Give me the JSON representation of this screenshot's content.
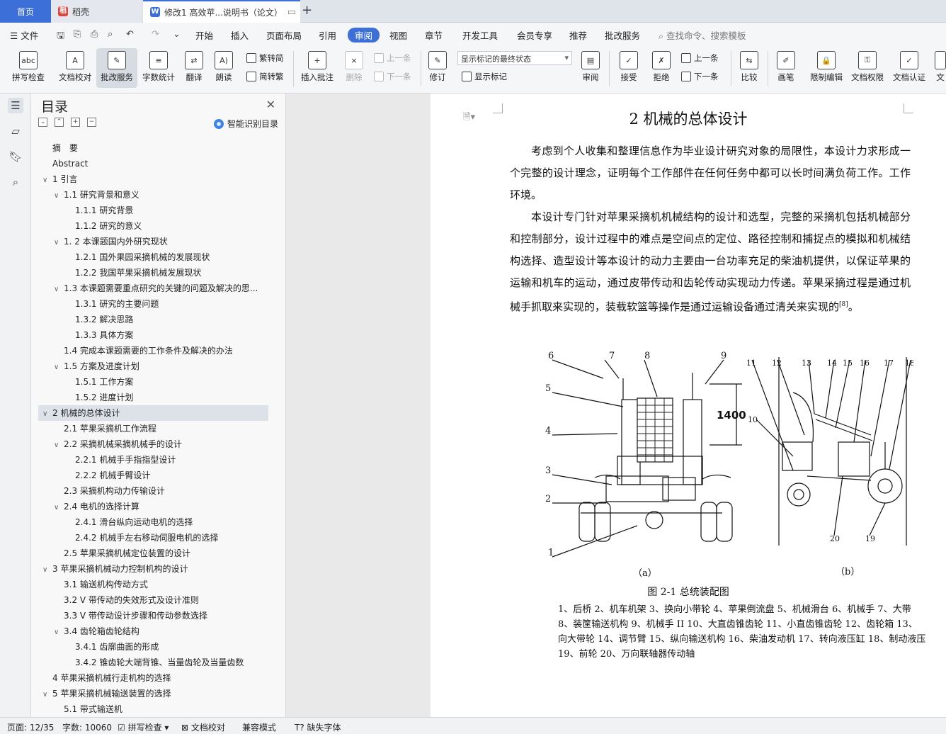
{
  "tabs": {
    "home": "首页",
    "daoke": "稻壳",
    "doc": "修改1 高效苹...说明书（论文）"
  },
  "menu": {
    "file": "文件",
    "items": [
      "开始",
      "插入",
      "页面布局",
      "引用",
      "审阅",
      "视图",
      "章节",
      "开发工具",
      "会员专享",
      "推荐",
      "批改服务"
    ],
    "active": "审阅",
    "search": "查找命令、搜索模板"
  },
  "ribbon": {
    "spellcheck": "拼写检查",
    "doccheck": "文档校对",
    "correction": "批改服务",
    "wordcount": "字数统计",
    "translate": "翻译",
    "read": "朗读",
    "trad": "繁转简",
    "simp": "简转繁",
    "insert_comment": "插入批注",
    "delete": "删除",
    "prev_comment": "上一条",
    "next_comment": "下一条",
    "revise": "修订",
    "markup_state": "显示标记的最终状态",
    "show_markup": "显示标记",
    "review": "审阅",
    "accept": "接受",
    "reject": "拒绝",
    "prev_change": "上一条",
    "next_change": "下一条",
    "compare": "比较",
    "pen": "画笔",
    "restrict": "限制编辑",
    "permission": "文档权限",
    "certify": "文档认证",
    "cut_label": "文"
  },
  "toc": {
    "title": "目录",
    "smart": "智能识别目录",
    "items": [
      {
        "text": "摘　要",
        "level": 0,
        "chev": ""
      },
      {
        "text": "Abstract",
        "level": 0,
        "chev": ""
      },
      {
        "text": "1 引言",
        "level": 0,
        "chev": "∨"
      },
      {
        "text": "1.1 研究背景和意义",
        "level": 1,
        "chev": "∨"
      },
      {
        "text": "1.1.1 研究背景",
        "level": 2,
        "chev": ""
      },
      {
        "text": "1.1.2 研究的意义",
        "level": 2,
        "chev": ""
      },
      {
        "text": "1. 2 本课题国内外研究现状",
        "level": 1,
        "chev": "∨"
      },
      {
        "text": "1.2.1 国外果园采摘机械的发展现状",
        "level": 2,
        "chev": ""
      },
      {
        "text": "1.2.2 我国苹果采摘机械发展现状",
        "level": 2,
        "chev": ""
      },
      {
        "text": "1.3 本课题需要重点研究的关键的问题及解决的思...",
        "level": 1,
        "chev": "∨"
      },
      {
        "text": "1.3.1  研究的主要问题",
        "level": 2,
        "chev": ""
      },
      {
        "text": "1.3.2  解决思路",
        "level": 2,
        "chev": ""
      },
      {
        "text": "1.3.3 具体方案",
        "level": 2,
        "chev": ""
      },
      {
        "text": "1.4 完成本课题需要的工作条件及解决的办法",
        "level": 1,
        "chev": ""
      },
      {
        "text": "1.5  方案及进度计划",
        "level": 1,
        "chev": "∨"
      },
      {
        "text": "1.5.1  工作方案",
        "level": 2,
        "chev": ""
      },
      {
        "text": "1.5.2 进度计划",
        "level": 2,
        "chev": ""
      },
      {
        "text": "2 机械的总体设计",
        "level": 0,
        "chev": "∨",
        "selected": true
      },
      {
        "text": "2.1 苹果采摘机工作流程",
        "level": 1,
        "chev": ""
      },
      {
        "text": "2.2 采摘机械采摘机械手的设计",
        "level": 1,
        "chev": "∨"
      },
      {
        "text": "2.2.1 机械手手指指型设计",
        "level": 2,
        "chev": ""
      },
      {
        "text": "2.2.2 机械手臂设计",
        "level": 2,
        "chev": ""
      },
      {
        "text": "2.3 采摘机构动力传输设计",
        "level": 1,
        "chev": ""
      },
      {
        "text": "2.4 电机的选择计算",
        "level": 1,
        "chev": "∨"
      },
      {
        "text": "2.4.1 滑台纵向运动电机的选择",
        "level": 2,
        "chev": ""
      },
      {
        "text": "2.4.2 机械手左右移动伺服电机的选择",
        "level": 2,
        "chev": ""
      },
      {
        "text": "2.5 苹果采摘机械定位装置的设计",
        "level": 1,
        "chev": ""
      },
      {
        "text": "3 苹果采摘机械动力控制机构的设计",
        "level": 0,
        "chev": "∨"
      },
      {
        "text": "3.1 输送机构传动方式",
        "level": 1,
        "chev": ""
      },
      {
        "text": "3.2 V 带传动的失效形式及设计准则",
        "level": 1,
        "chev": ""
      },
      {
        "text": "3.3 V 带传动设计步骤和传动参数选择",
        "level": 1,
        "chev": ""
      },
      {
        "text": "3.4 齿轮箱齿轮结构",
        "level": 1,
        "chev": "∨"
      },
      {
        "text": "3.4.1 齿廓曲面的形成",
        "level": 2,
        "chev": ""
      },
      {
        "text": "3.4.2 锥齿轮大端背锥、当量齿轮及当量齿数",
        "level": 2,
        "chev": ""
      },
      {
        "text": "4 苹果采摘机械行走机构的选择",
        "level": 0,
        "chev": ""
      },
      {
        "text": "5 苹果采摘机械输送装置的选择",
        "level": 0,
        "chev": "∨"
      },
      {
        "text": "5.1 带式输送机",
        "level": 1,
        "chev": ""
      }
    ]
  },
  "document": {
    "heading": "2 机械的总体设计",
    "para1": "考虑到个人收集和整理信息作为毕业设计研究对象的局限性，本设计力求形成一个完整的设计理念，证明每个工作部件在任何任务中都可以长时间满负荷工作。工作环境。",
    "para2": "本设计专门针对苹果采摘机机械结构的设计和选型，完整的采摘机包括机械部分和控制部分，设计过程中的难点是空间点的定位、路径控制和捕捉点的模拟和机械结构选择、造型设计等本设计的动力主要由一台功率充足的柴油机提供，以保证苹果的运输和机车的运动，通过皮带传动和齿轮传动实现动力传递。苹果采摘过程是通过机械手抓取来实现的，装载软篮等操作是通过运输设备通过清关来实现的",
    "para2_ref": "[8]",
    "para2_end": "。",
    "fig_a": "（a）",
    "fig_b": "（b）",
    "dim": "1400",
    "caption": "图 2-1  总统装配图",
    "legend": [
      "1、后桥   2、机车机架  3、换向小带轮   4、苹果倒流盘  5、机械滑台  6、机械手  7、大带",
      "8、装筐输送机构 9、机械手 II    10、大直齿锥齿轮  11、小直齿锥齿轮  12、齿轮箱    13、",
      "向大带轮    14、调节臂 15、纵向输送机构  16、柴油发动机  17、转向液压缸  18、制动液压",
      "19、前轮  20、万向联轴器传动轴"
    ],
    "labels_a": [
      "6",
      "7",
      "8",
      "9",
      "5",
      "4",
      "3",
      "2",
      "1"
    ],
    "labels_b": [
      "11",
      "12",
      "13",
      "14",
      "15",
      "16",
      "17",
      "18",
      "10",
      "20",
      "19"
    ]
  },
  "status": {
    "page": "页面: 12/35",
    "words": "字数: 10060",
    "spell": "拼写检查",
    "proof": "文档校对",
    "compat": "兼容模式",
    "fonts": "缺失字体"
  }
}
